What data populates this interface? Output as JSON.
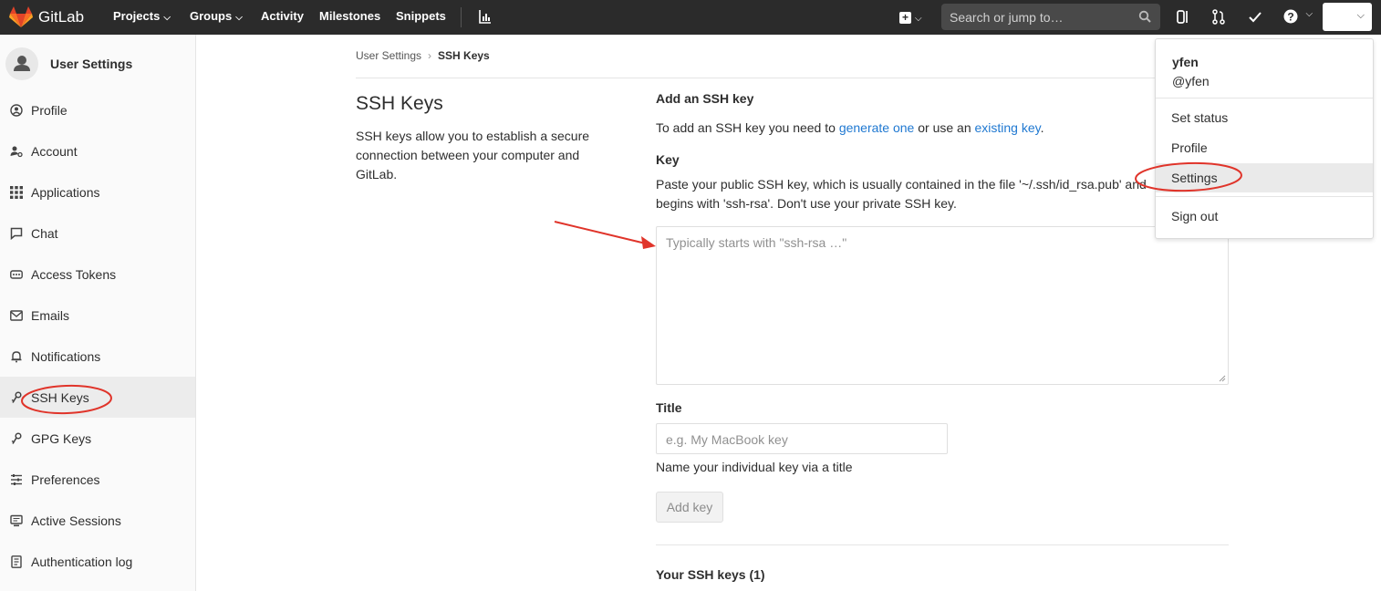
{
  "header": {
    "brand": "GitLab",
    "nav": [
      "Projects",
      "Groups",
      "Activity",
      "Milestones",
      "Snippets"
    ],
    "search_placeholder": "Search or jump to…"
  },
  "sidebar": {
    "title": "User Settings",
    "items": [
      {
        "label": "Profile",
        "icon": "profile-icon"
      },
      {
        "label": "Account",
        "icon": "account-icon"
      },
      {
        "label": "Applications",
        "icon": "applications-icon"
      },
      {
        "label": "Chat",
        "icon": "chat-icon"
      },
      {
        "label": "Access Tokens",
        "icon": "token-icon"
      },
      {
        "label": "Emails",
        "icon": "email-icon"
      },
      {
        "label": "Notifications",
        "icon": "bell-icon"
      },
      {
        "label": "SSH Keys",
        "icon": "key-icon",
        "active": true
      },
      {
        "label": "GPG Keys",
        "icon": "key-icon"
      },
      {
        "label": "Preferences",
        "icon": "sliders-icon"
      },
      {
        "label": "Active Sessions",
        "icon": "monitor-icon"
      },
      {
        "label": "Authentication log",
        "icon": "log-icon"
      }
    ]
  },
  "breadcrumb": {
    "parent": "User Settings",
    "separator": "›",
    "current": "SSH Keys"
  },
  "intro": {
    "title": "SSH Keys",
    "description": "SSH keys allow you to establish a secure connection between your computer and GitLab."
  },
  "form": {
    "heading": "Add an SSH key",
    "intro_prefix": "To add an SSH key you need to ",
    "link_generate": "generate one",
    "intro_middle": " or use an ",
    "link_existing": "existing key",
    "intro_suffix": ".",
    "key_label": "Key",
    "key_help": "Paste your public SSH key, which is usually contained in the file '~/.ssh/id_rsa.pub' and begins with 'ssh-rsa'. Don't use your private SSH key.",
    "key_placeholder": "Typically starts with \"ssh-rsa …\"",
    "title_label": "Title",
    "title_placeholder": "e.g. My MacBook key",
    "title_help": "Name your individual key via a title",
    "submit_label": "Add key",
    "your_keys_heading": "Your SSH keys (1)"
  },
  "user_menu": {
    "name": "yfen",
    "username": "@yfen",
    "items": [
      "Set status",
      "Profile",
      "Settings",
      "Sign out"
    ],
    "highlighted": "Settings"
  },
  "colors": {
    "navbar": "#2b2b2b",
    "link": "#1f78d1",
    "annotation": "#e0342a"
  }
}
